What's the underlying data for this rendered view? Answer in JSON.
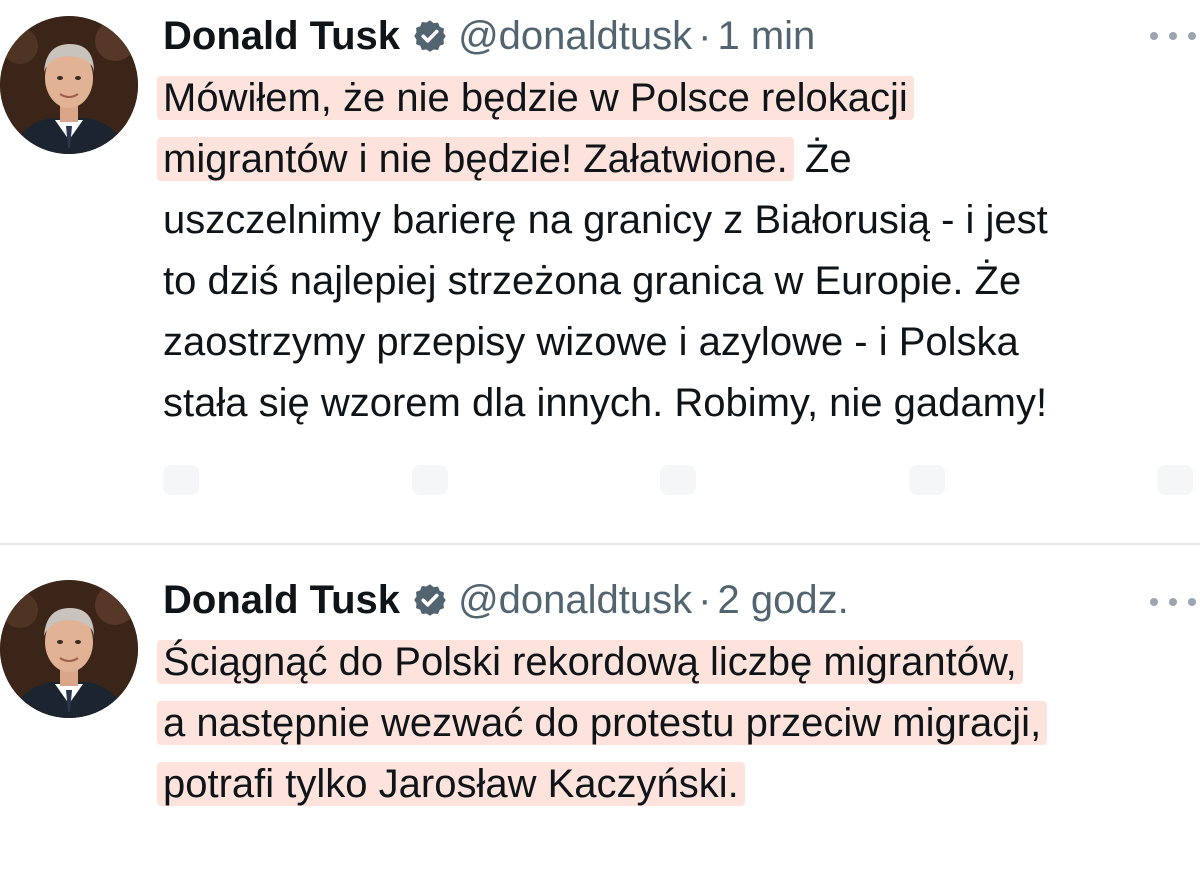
{
  "tweets": [
    {
      "author": {
        "name": "Donald Tusk",
        "handle": "@donaldtusk",
        "verified": true,
        "avatar_icon": "portrait-avatar"
      },
      "separator": "·",
      "time": "1 min",
      "more_icon": "more-options-icon",
      "lines": [
        {
          "highlighted": "Mówiłem, że nie będzie w Polsce relokacji",
          "rest": ""
        },
        {
          "highlighted": "migrantów i nie będzie! Załatwione.",
          "rest": " Że"
        },
        {
          "highlighted": "",
          "rest": "uszczelnimy barierę na granicy z Białorusią - i jest"
        },
        {
          "highlighted": "",
          "rest": "to dziś najlepiej strzeżona granica w Europie. Że"
        },
        {
          "highlighted": "",
          "rest": "zaostrzymy przepisy wizowe i azylowe - i Polska"
        },
        {
          "highlighted": "",
          "rest": "stała się wzorem dla innych. Robimy, nie gadamy!"
        }
      ]
    },
    {
      "author": {
        "name": "Donald Tusk",
        "handle": "@donaldtusk",
        "verified": true,
        "avatar_icon": "portrait-avatar"
      },
      "separator": "·",
      "time": "2 godz.",
      "more_icon": "more-options-icon",
      "lines": [
        {
          "highlighted": "Ściągnąć do Polski rekordową liczbę migrantów,",
          "rest": ""
        },
        {
          "highlighted": "a następnie wezwać do protestu przeciw migracji,",
          "rest": ""
        },
        {
          "highlighted": "potrafi tylko Jarosław Kaczyński.",
          "rest": ""
        }
      ]
    }
  ],
  "colors": {
    "text": "#0f1419",
    "secondary": "#536471",
    "highlight": "#fde3dc",
    "verified_badge": "#536471",
    "divider": "#e4e7ea"
  }
}
